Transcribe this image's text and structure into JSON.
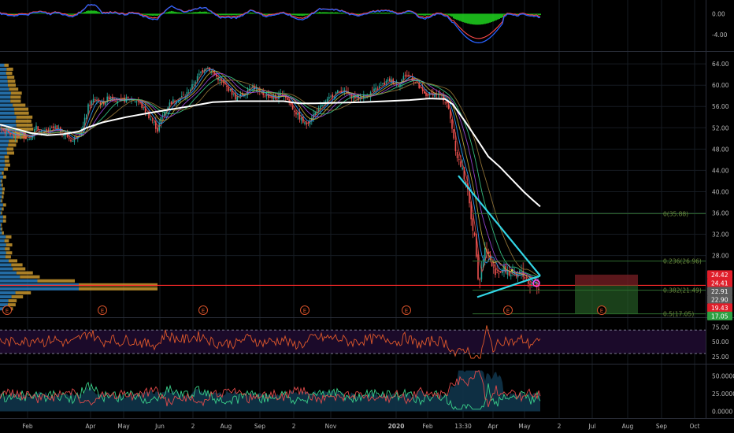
{
  "colors": {
    "background": "#000000",
    "grid": "#161b22",
    "up_candle": "#26a69a",
    "down_candle": "#ef5350",
    "ma_white": "#ffffff",
    "trendline": "#33d6e6",
    "support_line": "#ff2a2a",
    "volume_profile_blue": "#2a7fc1",
    "volume_profile_gold": "#c8962e",
    "rsi_line": "#e0592a",
    "rsi_band": "#1b0a2a",
    "macd_fill": "#1fd31f",
    "macd_line_blue": "#2962ff",
    "macd_line_red": "#ff4a4a",
    "label_red": "#e01e2a",
    "label_gray": "#5c5c5c",
    "label_green": "#2ea043",
    "axis_text": "#b8b8b8"
  },
  "chart_data": [
    {
      "type": "line",
      "panel": "macd",
      "y_ticks": [
        "0.00",
        "-4.00"
      ],
      "ylim": [
        -6.5,
        2.0
      ]
    },
    {
      "type": "candlestick",
      "panel": "price",
      "x_ticks": [
        "Feb",
        "Apr",
        "May",
        "Jun",
        "2",
        "Aug",
        "Sep",
        "2",
        "Nov",
        "2020",
        "Feb",
        "13:30",
        "Apr",
        "May",
        "2",
        "Jul",
        "Aug",
        "Sep",
        "Oct"
      ],
      "y_ticks": [
        "64.00",
        "60.00",
        "56.00",
        "52.00",
        "48.00",
        "44.00",
        "40.00",
        "36.00",
        "32.00",
        "28.00"
      ],
      "ylim": [
        17.0,
        65.5
      ],
      "price_path": [
        [
          0,
          52.0
        ],
        [
          10,
          51.0
        ],
        [
          18,
          50.5
        ],
        [
          28,
          50.8
        ],
        [
          36,
          49.8
        ],
        [
          46,
          52.0
        ],
        [
          55,
          51.0
        ],
        [
          70,
          52.0
        ],
        [
          82,
          50.8
        ],
        [
          92,
          49.5
        ],
        [
          105,
          52.0
        ],
        [
          112,
          56.0
        ],
        [
          120,
          57.5
        ],
        [
          130,
          56.5
        ],
        [
          140,
          58.0
        ],
        [
          150,
          57.0
        ],
        [
          165,
          57.5
        ],
        [
          175,
          57.0
        ],
        [
          185,
          55.0
        ],
        [
          195,
          53.0
        ],
        [
          200,
          51.5
        ],
        [
          205,
          54.0
        ],
        [
          215,
          56.5
        ],
        [
          225,
          57.5
        ],
        [
          235,
          58.0
        ],
        [
          245,
          60.0
        ],
        [
          255,
          62.5
        ],
        [
          262,
          63.5
        ],
        [
          272,
          62.0
        ],
        [
          282,
          60.5
        ],
        [
          292,
          59.0
        ],
        [
          300,
          57.5
        ],
        [
          310,
          58.5
        ],
        [
          320,
          60.0
        ],
        [
          330,
          58.5
        ],
        [
          340,
          58.0
        ],
        [
          350,
          57.5
        ],
        [
          360,
          58.5
        ],
        [
          370,
          56.0
        ],
        [
          380,
          54.0
        ],
        [
          388,
          52.5
        ],
        [
          395,
          54.0
        ],
        [
          405,
          55.5
        ],
        [
          415,
          57.0
        ],
        [
          425,
          58.5
        ],
        [
          435,
          59.0
        ],
        [
          445,
          58.0
        ],
        [
          455,
          57.5
        ],
        [
          465,
          58.0
        ],
        [
          475,
          59.0
        ],
        [
          485,
          60.0
        ],
        [
          495,
          61.0
        ],
        [
          505,
          60.0
        ],
        [
          515,
          62.0
        ],
        [
          522,
          61.5
        ],
        [
          530,
          60.0
        ],
        [
          540,
          58.0
        ],
        [
          550,
          58.5
        ],
        [
          560,
          58.0
        ],
        [
          568,
          56.5
        ],
        [
          574,
          52.0
        ],
        [
          580,
          47.0
        ],
        [
          586,
          44.5
        ],
        [
          592,
          41.5
        ],
        [
          598,
          35.5
        ],
        [
          604,
          30.0
        ],
        [
          608,
          22.5
        ],
        [
          612,
          26.5
        ],
        [
          617,
          30.0
        ],
        [
          621,
          27.5
        ],
        [
          626,
          25.5
        ],
        [
          632,
          24.8
        ],
        [
          640,
          25.5
        ],
        [
          648,
          24.5
        ],
        [
          656,
          24.0
        ],
        [
          662,
          25.0
        ],
        [
          668,
          23.5
        ],
        [
          674,
          22.5
        ],
        [
          680,
          23.3
        ],
        [
          685,
          21.0
        ]
      ],
      "white_ma_path": [
        [
          0,
          52.6
        ],
        [
          20,
          51.8
        ],
        [
          40,
          51.0
        ],
        [
          60,
          50.6
        ],
        [
          80,
          50.8
        ],
        [
          100,
          51.3
        ],
        [
          110,
          52.0
        ],
        [
          130,
          53.0
        ],
        [
          160,
          54.0
        ],
        [
          190,
          54.8
        ],
        [
          210,
          55.3
        ],
        [
          240,
          56.0
        ],
        [
          270,
          56.8
        ],
        [
          300,
          57.0
        ],
        [
          330,
          57.0
        ],
        [
          360,
          57.0
        ],
        [
          380,
          56.6
        ],
        [
          400,
          56.6
        ],
        [
          430,
          56.7
        ],
        [
          460,
          56.8
        ],
        [
          490,
          57.0
        ],
        [
          520,
          57.2
        ],
        [
          545,
          57.5
        ],
        [
          565,
          57.4
        ],
        [
          575,
          56.4
        ],
        [
          590,
          53.3
        ],
        [
          605,
          50.0
        ],
        [
          620,
          46.6
        ],
        [
          635,
          44.6
        ],
        [
          650,
          42.3
        ],
        [
          665,
          40.0
        ],
        [
          676,
          38.5
        ],
        [
          686,
          37.2
        ]
      ],
      "fib_labels": [
        "0(35.88)",
        "0.236(26.96)",
        "0.382(21.49)",
        "0.5(17.05)"
      ],
      "fib_levels": [
        35.88,
        26.96,
        21.49,
        17.05
      ],
      "support_level": 22.41,
      "trendline_upper": [
        [
          582,
          43.0
        ],
        [
          686,
          24.2
        ]
      ],
      "trendline_lower": [
        [
          606,
          20.2
        ],
        [
          686,
          24.2
        ]
      ],
      "earnings_marks": [
        "E",
        "E",
        "E",
        "E",
        "E",
        "E",
        "E"
      ],
      "price_labels": [
        {
          "text": "24.42",
          "kind": "red"
        },
        {
          "text": "24.41",
          "kind": "red"
        },
        {
          "text": "22.91",
          "kind": "gray"
        },
        {
          "text": "22.90",
          "kind": "gray"
        },
        {
          "text": "19.43",
          "kind": "red"
        },
        {
          "text": "17.05",
          "kind": "green"
        }
      ]
    },
    {
      "type": "line",
      "panel": "rsi",
      "y_ticks": [
        "75.00",
        "50.00",
        "25.00"
      ],
      "ylim": [
        18,
        85
      ],
      "bands": [
        70,
        30
      ]
    },
    {
      "type": "line",
      "panel": "dmi",
      "y_ticks": [
        "50.0000",
        "25.0000",
        "0.0000"
      ],
      "ylim": [
        -5,
        62
      ]
    }
  ]
}
